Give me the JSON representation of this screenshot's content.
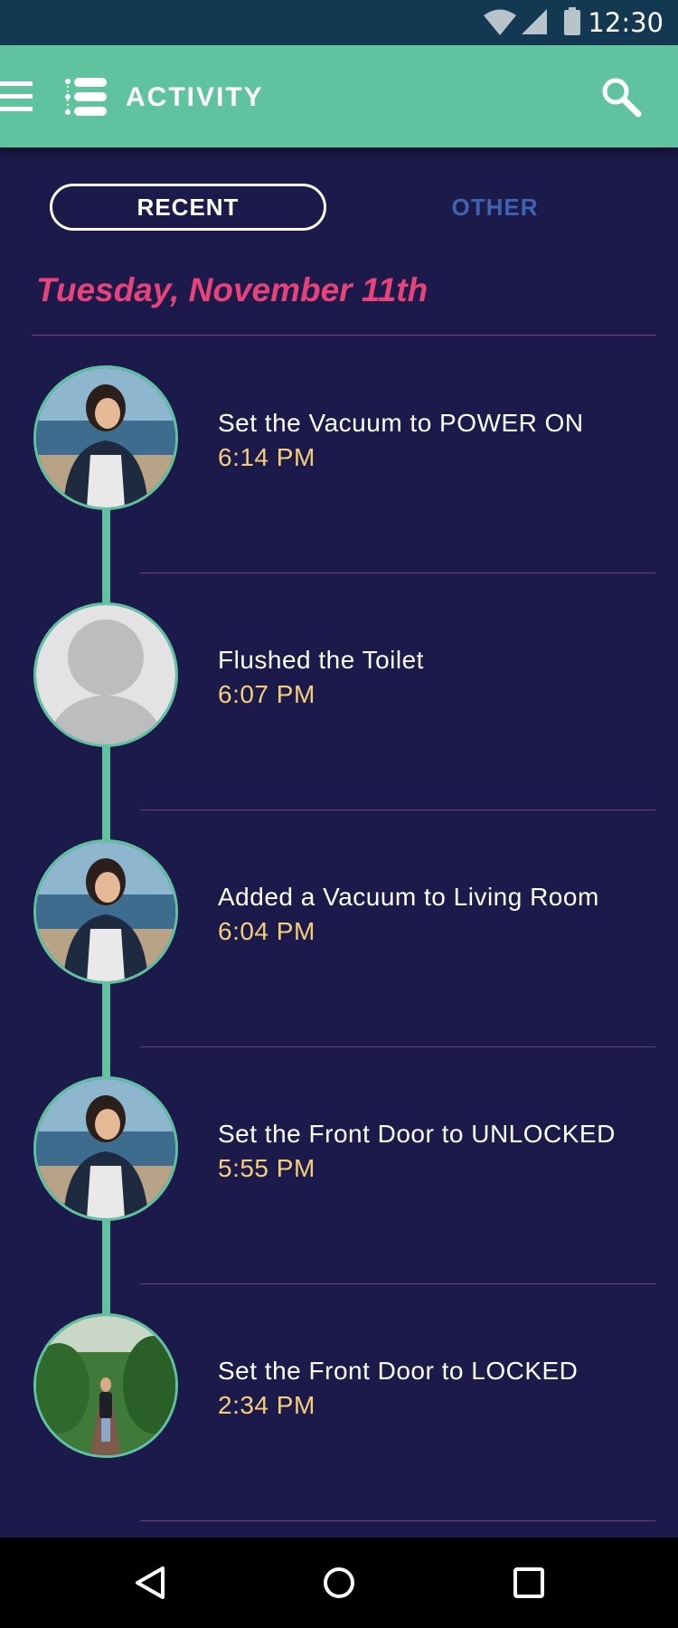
{
  "status_bar": {
    "time": "12:30",
    "icons": [
      "wifi-icon",
      "cellular-signal-icon",
      "battery-icon"
    ]
  },
  "app_bar": {
    "title": "ACTIVITY",
    "icons": [
      "menu-icon",
      "activity-list-icon",
      "search-icon"
    ]
  },
  "tabs": {
    "recent": "RECENT",
    "other": "OTHER",
    "selected": "RECENT"
  },
  "date_heading": "Tuesday, November 11th",
  "activities": [
    {
      "text": "Set the Vacuum to POWER ON",
      "time": "6:14 PM",
      "avatar": "user-photo-beach"
    },
    {
      "text": "Flushed the Toilet",
      "time": "6:07 PM",
      "avatar": "default-avatar"
    },
    {
      "text": "Added a Vacuum to Living Room",
      "time": "6:04 PM",
      "avatar": "user-photo-beach"
    },
    {
      "text": "Set the Front Door to UNLOCKED",
      "time": "5:55 PM",
      "avatar": "user-photo-beach"
    },
    {
      "text": "Set the Front Door to LOCKED",
      "time": "2:34 PM",
      "avatar": "user-photo-garden"
    }
  ],
  "nav_bar": {
    "icons": [
      "back-icon",
      "home-icon",
      "recents-icon"
    ]
  },
  "colors": {
    "app_bar": "#5fc3a0",
    "background": "#1b1a4a",
    "date_heading": "#e7437a",
    "time_text": "#f5cf7c",
    "inactive_tab": "#3f63b0"
  }
}
